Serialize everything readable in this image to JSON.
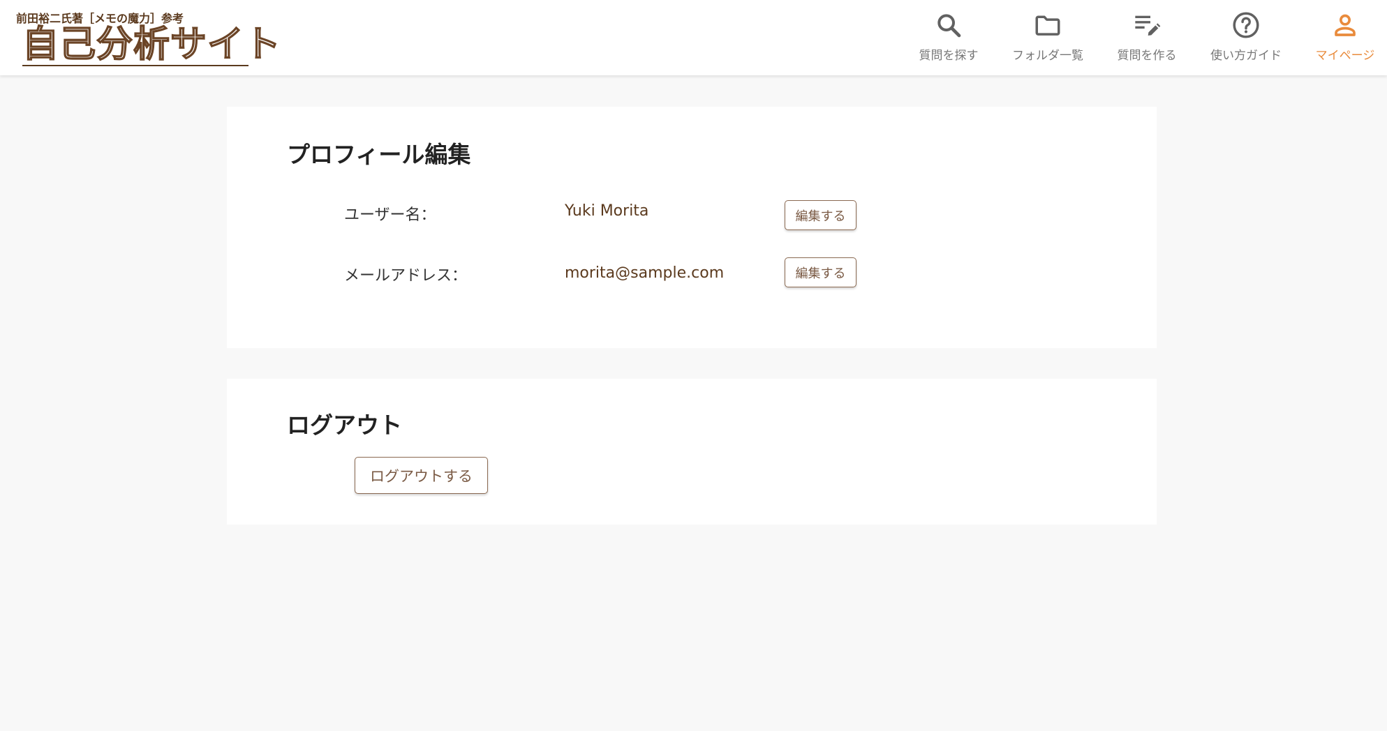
{
  "brand": {
    "subtitle": "前田裕二氏著［メモの魔力］参考",
    "title": "自己分析サイト"
  },
  "nav": {
    "items": [
      {
        "label": "質問を探す",
        "icon": "search-icon"
      },
      {
        "label": "フォルダ一覧",
        "icon": "folder-icon"
      },
      {
        "label": "質問を作る",
        "icon": "edit-note-icon"
      },
      {
        "label": "使い方ガイド",
        "icon": "help-circle-icon"
      },
      {
        "label": "マイページ",
        "icon": "person-icon",
        "active": true
      }
    ]
  },
  "profile": {
    "title": "プロフィール編集",
    "rows": [
      {
        "label": "ユーザー名：",
        "value": "Yuki Morita",
        "button": "編集する"
      },
      {
        "label": "メールアドレス：",
        "value": "morita@sample.com",
        "button": "編集する"
      }
    ]
  },
  "logout": {
    "title": "ログアウト",
    "button": "ログアウトする"
  },
  "colors": {
    "accent": "#e98b3c",
    "brand_brown": "#5b3a1e",
    "nav_gray": "#616161",
    "background": "#f8f8f8"
  }
}
